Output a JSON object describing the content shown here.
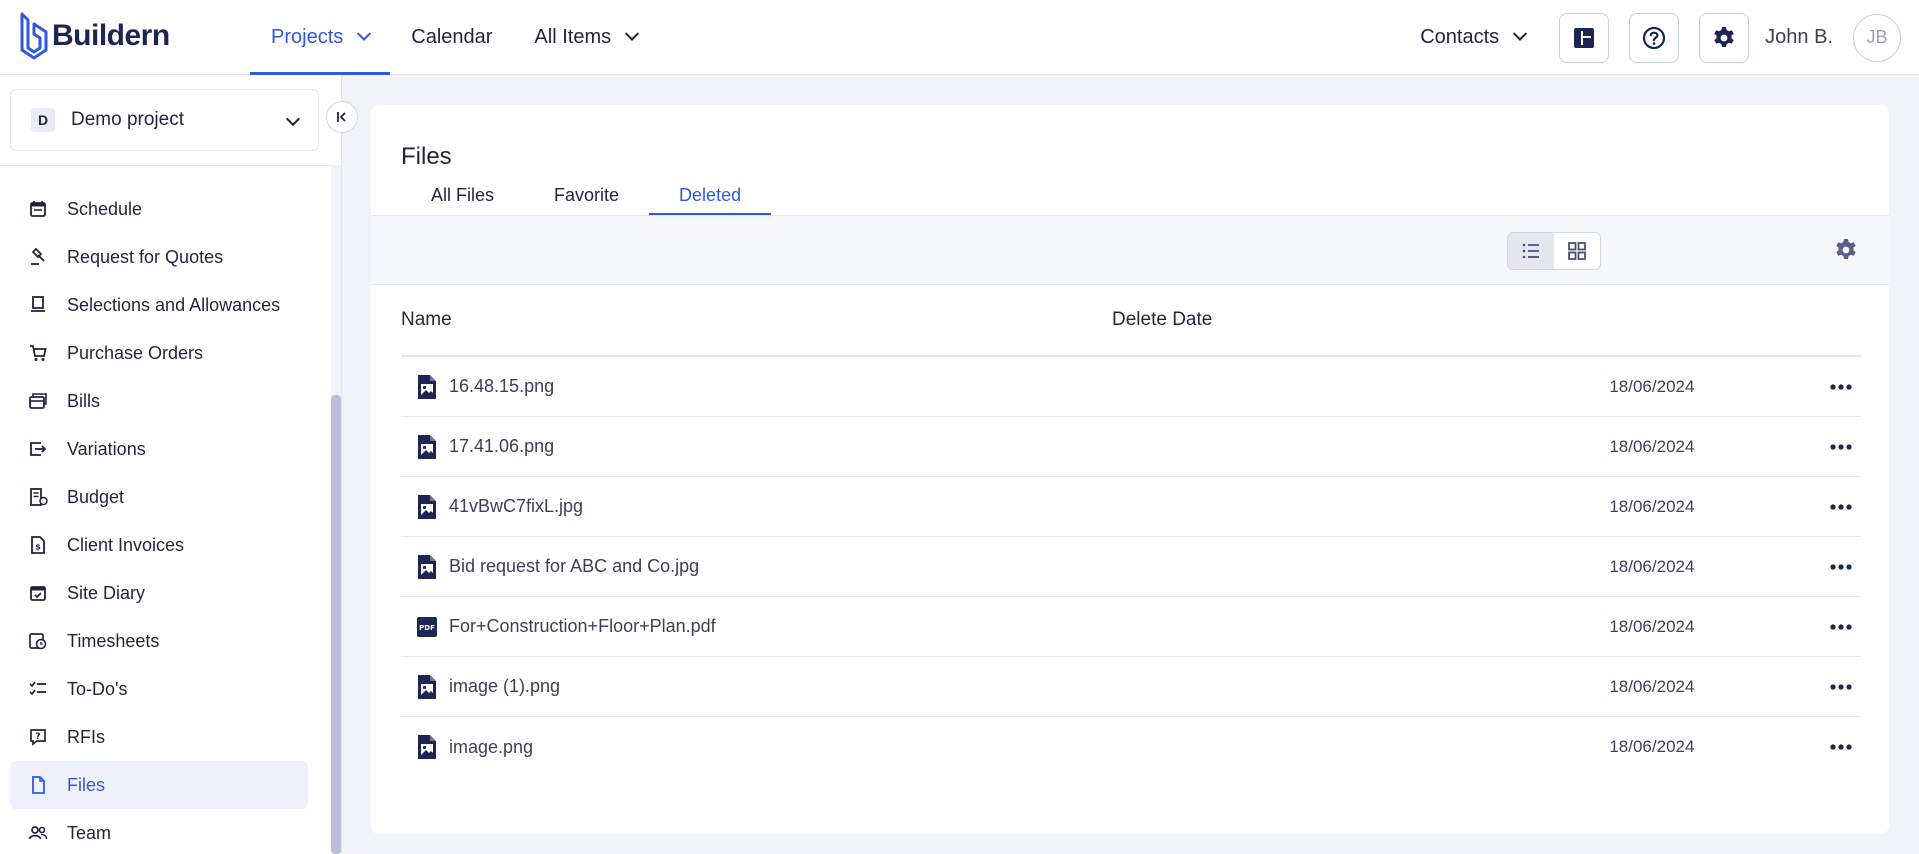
{
  "app": {
    "logo_text": "Buildern"
  },
  "nav": {
    "items": [
      {
        "label": "Projects",
        "active": true,
        "dropdown": true
      },
      {
        "label": "Calendar",
        "active": false,
        "dropdown": false
      },
      {
        "label": "All Items",
        "active": false,
        "dropdown": true
      }
    ],
    "contacts_label": "Contacts",
    "user_name": "John B.",
    "avatar_initials": "JB"
  },
  "sidebar": {
    "project_badge": "D",
    "project_name": "Demo project",
    "items": [
      {
        "label": "Schedule",
        "icon": "calendar-icon",
        "active": false
      },
      {
        "label": "Request for Quotes",
        "icon": "gavel-icon",
        "active": false
      },
      {
        "label": "Selections and Allowances",
        "icon": "selection-icon",
        "active": false
      },
      {
        "label": "Purchase Orders",
        "icon": "cart-icon",
        "active": false
      },
      {
        "label": "Bills",
        "icon": "bills-icon",
        "active": false
      },
      {
        "label": "Variations",
        "icon": "variations-icon",
        "active": false
      },
      {
        "label": "Budget",
        "icon": "budget-icon",
        "active": false
      },
      {
        "label": "Client Invoices",
        "icon": "invoice-icon",
        "active": false
      },
      {
        "label": "Site Diary",
        "icon": "diary-icon",
        "active": false
      },
      {
        "label": "Timesheets",
        "icon": "timesheet-icon",
        "active": false
      },
      {
        "label": "To-Do's",
        "icon": "todo-icon",
        "active": false
      },
      {
        "label": "RFIs",
        "icon": "rfi-icon",
        "active": false
      },
      {
        "label": "Files",
        "icon": "file-icon",
        "active": true
      },
      {
        "label": "Team",
        "icon": "team-icon",
        "active": false
      }
    ]
  },
  "main": {
    "title": "Files",
    "tabs": [
      {
        "label": "All Files",
        "active": false
      },
      {
        "label": "Favorite",
        "active": false
      },
      {
        "label": "Deleted",
        "active": true
      }
    ],
    "columns": {
      "name": "Name",
      "delete_date": "Delete Date"
    },
    "files": [
      {
        "name": "16.48.15.png",
        "type": "image",
        "date": "18/06/2024"
      },
      {
        "name": "17.41.06.png",
        "type": "image",
        "date": "18/06/2024"
      },
      {
        "name": "41vBwC7fixL.jpg",
        "type": "image",
        "date": "18/06/2024"
      },
      {
        "name": "Bid request for ABC and Co.jpg",
        "type": "image",
        "date": "18/06/2024"
      },
      {
        "name": "For+Construction+Floor+Plan.pdf",
        "type": "pdf",
        "date": "18/06/2024"
      },
      {
        "name": "image (1).png",
        "type": "image",
        "date": "18/06/2024"
      },
      {
        "name": "image.png",
        "type": "image",
        "date": "18/06/2024"
      }
    ]
  },
  "colors": {
    "accent": "#2f5ae0",
    "text": "#1f2440",
    "active_bg": "#eef1fb"
  }
}
